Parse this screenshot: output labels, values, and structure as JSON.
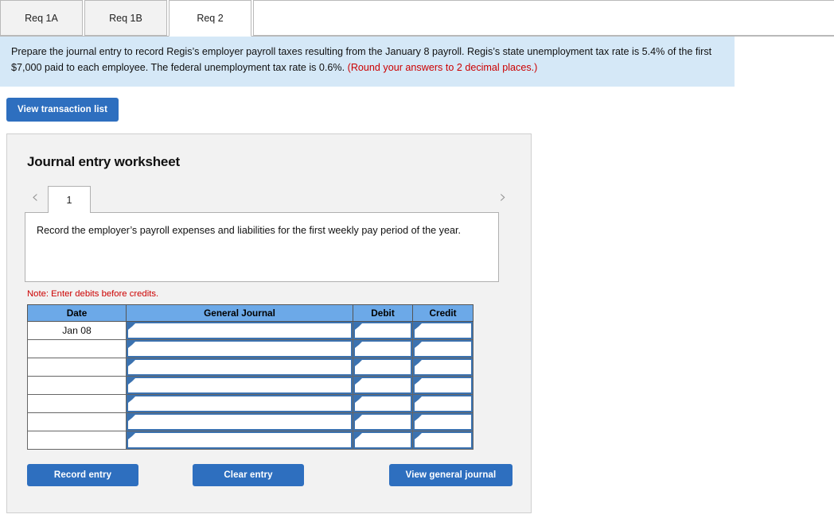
{
  "tabs": [
    {
      "label": "Req 1A",
      "active": false
    },
    {
      "label": "Req 1B",
      "active": false
    },
    {
      "label": "Req 2",
      "active": true
    }
  ],
  "banner": {
    "text": "Prepare the journal entry to record Regis’s employer payroll taxes resulting from the January 8 payroll. Regis’s state unemployment tax rate is 5.4% of the first $7,000 paid to each employee. The federal unemployment tax rate is 0.6%. ",
    "hint": "(Round your answers to 2 decimal places.)"
  },
  "toolbar": {
    "view_transaction_list": "View transaction list"
  },
  "worksheet": {
    "title": "Journal entry worksheet",
    "prev_icon": "‹",
    "next_icon": "›",
    "page_number": "1",
    "description": "Record the employer’s payroll expenses and liabilities for the first weekly pay period of the year.",
    "note": "Note: Enter debits before credits."
  },
  "table": {
    "headers": [
      "Date",
      "General Journal",
      "Debit",
      "Credit"
    ],
    "rows": [
      {
        "date": "Jan 08",
        "general_journal": "",
        "debit": "",
        "credit": ""
      },
      {
        "date": "",
        "general_journal": "",
        "debit": "",
        "credit": ""
      },
      {
        "date": "",
        "general_journal": "",
        "debit": "",
        "credit": ""
      },
      {
        "date": "",
        "general_journal": "",
        "debit": "",
        "credit": ""
      },
      {
        "date": "",
        "general_journal": "",
        "debit": "",
        "credit": ""
      },
      {
        "date": "",
        "general_journal": "",
        "debit": "",
        "credit": ""
      },
      {
        "date": "",
        "general_journal": "",
        "debit": "",
        "credit": ""
      }
    ]
  },
  "footer": {
    "record_entry": "Record entry",
    "clear_entry": "Clear entry",
    "view_general_journal": "View general journal"
  },
  "colors": {
    "banner_bg": "#d5e8f7",
    "button_blue": "#2e6fbf",
    "table_header_blue": "#6ca9e8",
    "cell_border_blue": "#3b72b0",
    "warning_red": "#cc0000",
    "panel_bg": "#f2f2f2"
  }
}
